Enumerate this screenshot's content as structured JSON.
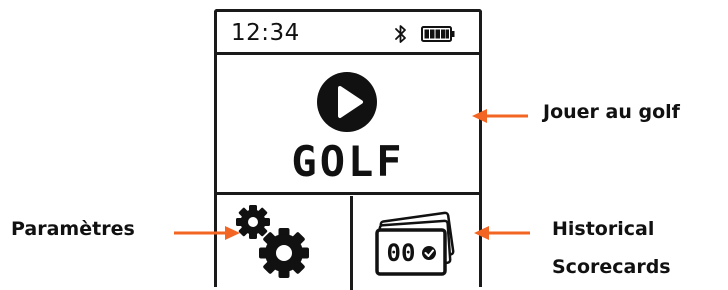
{
  "status_bar": {
    "time": "12:34",
    "bluetooth_icon": "bluetooth-icon",
    "battery_icon": "battery-full-icon"
  },
  "menu": {
    "play": {
      "label": "GOLF",
      "icon": "play-icon"
    },
    "settings": {
      "icon": "gears-icon"
    },
    "history": {
      "icon": "scorecards-icon",
      "card_text": "00"
    }
  },
  "callouts": {
    "play": "Jouer au golf",
    "settings": "Paramètres",
    "history_line1": "Historical",
    "history_line2": "Scorecards"
  },
  "colors": {
    "accent": "#f26522",
    "ink": "#1a1a1a",
    "background": "#ffffff"
  }
}
